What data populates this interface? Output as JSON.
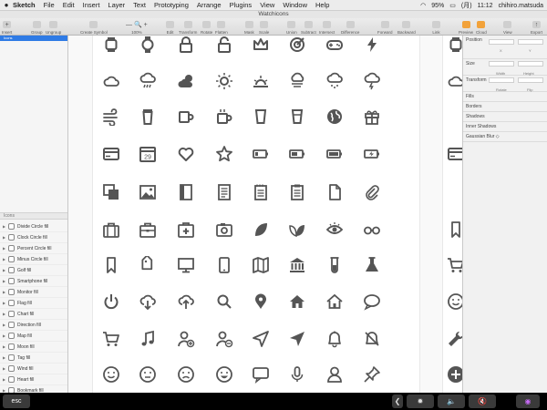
{
  "menubar": {
    "apple": "",
    "items": [
      "Sketch",
      "File",
      "Edit",
      "Insert",
      "Layer",
      "Text",
      "Prototyping",
      "Arrange",
      "Plugins",
      "View",
      "Window",
      "Help"
    ],
    "battery": "95%",
    "day": "(月)",
    "time": "11:12",
    "user": "chihiro.matsuda"
  },
  "window_title": "Watchicons",
  "toolbar": {
    "insert": "Insert",
    "group": "Group",
    "ungroup": "Ungroup",
    "create_symbol": "Create Symbol",
    "zoom_minus": "—",
    "zoom_plus": "+",
    "zoom": "100%",
    "edit": "Edit",
    "transform": "Transform",
    "rotate": "Rotate",
    "flatten": "Flatten",
    "mask": "Mask",
    "scale": "Scale",
    "union": "Union",
    "subtract": "Subtract",
    "intersect": "Intersect",
    "difference": "Difference",
    "forward": "Forward",
    "backward": "Backward",
    "link": "Link",
    "preview": "Preview",
    "cloud": "Cloud",
    "view": "View",
    "export": "Export"
  },
  "layers": {
    "selected_page": "Icons",
    "section_label": "Icons",
    "items": [
      "Divide Circle fill",
      "Clock Circle fill",
      "Percent Circle fill",
      "Minus Circle fill",
      "Golf fill",
      "Smartphone fill",
      "Monitor fill",
      "Flag fill",
      "Chart fill",
      "Direction fill",
      "Map fill",
      "Moon fill",
      "Tag fill",
      "Wind fill",
      "Heart fill",
      "Bookmark fill"
    ]
  },
  "inspector": {
    "position": "Position",
    "x": "X",
    "y": "Y",
    "size": "Size",
    "width": "Width",
    "height": "Height",
    "transform": "Transform",
    "rotate": "Rotate",
    "flip": "Flip",
    "fills": "Fills",
    "borders": "Borders",
    "shadows": "Shadows",
    "inner_shadows": "Inner Shadows",
    "gaussian_blur": "Gaussian Blur"
  },
  "icon_grid": [
    [
      "watch-icon",
      "watch-round-icon",
      "lock-icon",
      "unlock-icon",
      "crown-icon",
      "target-icon",
      "gamepad-icon",
      "bolt-icon"
    ],
    [
      "cloud-icon",
      "rain-cloud-icon",
      "sun-cloud-icon",
      "sun-icon",
      "sunrise-icon",
      "fog-cloud-icon",
      "snow-cloud-icon",
      "storm-cloud-icon"
    ],
    [
      "wind-icon",
      "coffee-cup-icon",
      "mug-icon",
      "hot-mug-icon",
      "glass-icon",
      "drink-glass-icon",
      "globe-icon",
      "gift-icon"
    ],
    [
      "credit-card-icon",
      "calendar-icon",
      "heart-icon",
      "star-icon",
      "battery-low-icon",
      "battery-half-icon",
      "battery-full-icon",
      "battery-charging-icon"
    ],
    [
      "copy-icon",
      "image-icon",
      "book-icon",
      "document-text-icon",
      "notepad-icon",
      "clipboard-icon",
      "file-icon",
      "paperclip-icon"
    ],
    [
      "suitcase-icon",
      "toolbox-icon",
      "first-aid-icon",
      "camera-icon",
      "leaf-icon",
      "leaves-icon",
      "eye-icon",
      "glasses-icon"
    ],
    [
      "bookmark-icon",
      "tag-icon",
      "monitor-icon",
      "smartphone-icon",
      "map-icon",
      "bank-icon",
      "test-tube-icon",
      "flask-icon"
    ],
    [
      "power-icon",
      "cloud-download-icon",
      "cloud-upload-icon",
      "search-icon",
      "map-pin-icon",
      "home-icon",
      "home-outline-icon",
      "speech-bubble-icon"
    ],
    [
      "shopping-cart-icon",
      "music-note-icon",
      "add-user-icon",
      "remove-user-icon",
      "location-arrow-icon",
      "navigate-icon",
      "bell-icon",
      "bell-off-icon"
    ],
    [
      "smile-icon",
      "neutral-face-icon",
      "sad-face-icon",
      "happy-face-icon",
      "chat-icon",
      "microphone-icon",
      "user-icon",
      "pin-icon"
    ]
  ],
  "partial_column": [
    "watch-icon",
    "cloud-icon",
    "",
    "credit-card-icon",
    "",
    "bookmark-icon",
    "shopping-cart-icon",
    "smile-icon",
    "wrench-icon",
    "add-circle-icon"
  ],
  "touchbar": {
    "esc": "esc",
    "chevron": "❮",
    "brightness": "✹",
    "volume": "🔈",
    "mute": "🔇",
    "siri": "◉"
  },
  "colors": {
    "icon": "#555555",
    "selection": "#2f7be5"
  }
}
